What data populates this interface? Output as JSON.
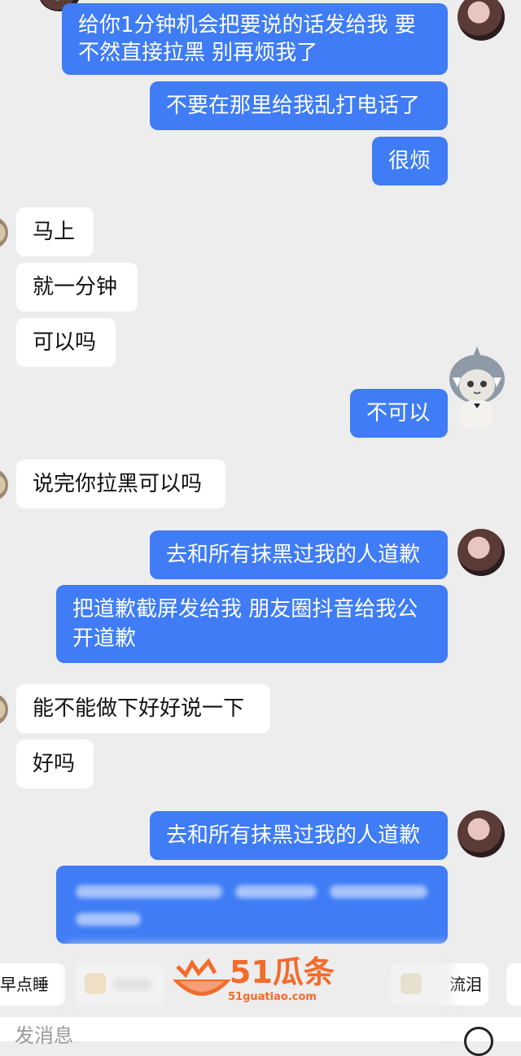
{
  "messages": [
    {
      "side": "mine",
      "text": "给你1分钟机会把要说的话发给我 要不然直接拉黑 别再烦我了"
    },
    {
      "side": "mine",
      "text": "不要在那里给我乱打电话了"
    },
    {
      "side": "mine",
      "text": "很烦"
    },
    {
      "side": "theirs",
      "text": "马上"
    },
    {
      "side": "theirs",
      "text": "就一分钟"
    },
    {
      "side": "theirs",
      "text": "可以吗"
    },
    {
      "side": "mine",
      "text": "不可以"
    },
    {
      "side": "theirs",
      "text": "说完你拉黑可以吗"
    },
    {
      "side": "mine",
      "text": "去和所有抹黑过我的人道歉"
    },
    {
      "side": "mine",
      "text": "把道歉截屏发给我 朋友圈抖音给我公开道歉"
    },
    {
      "side": "theirs",
      "text": "能不能做下好好说一下"
    },
    {
      "side": "theirs",
      "text": "好吗"
    },
    {
      "side": "mine",
      "text": "去和所有抹黑过我的人道歉"
    }
  ],
  "quick_replies": [
    "早点睡",
    "流泪"
  ],
  "watermark": {
    "brand": "51瓜条",
    "url": "51guatiao.com"
  },
  "input": {
    "placeholder": "发消息"
  },
  "icons": [
    "add-circle-icon",
    "shark-hood-cat-avatar",
    "girl-avatar"
  ],
  "colors": {
    "mine_bubble": "#3f7cf5",
    "theirs_bubble": "#ffffff",
    "background": "#ededed",
    "watermark": "#f26b2b"
  }
}
